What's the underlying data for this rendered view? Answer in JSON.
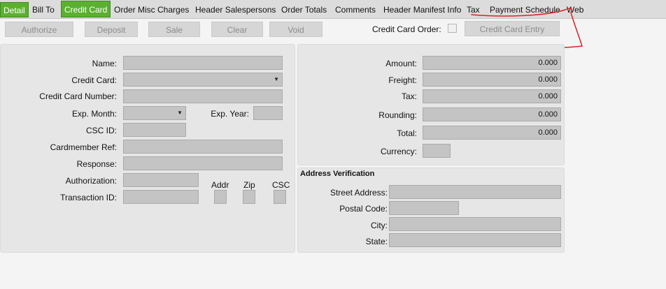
{
  "tabs": [
    {
      "label": "Detail"
    },
    {
      "label": "Bill To"
    },
    {
      "label": "Credit Card"
    },
    {
      "label": "Order Misc Charges"
    },
    {
      "label": "Header Salespersons"
    },
    {
      "label": "Order Totals"
    },
    {
      "label": "Comments"
    },
    {
      "label": "Header Manifest Info"
    },
    {
      "label": "Tax"
    },
    {
      "label": "Payment Schedule"
    },
    {
      "label": "Web"
    }
  ],
  "toolbar": {
    "authorize": "Authorize",
    "deposit": "Deposit",
    "sale": "Sale",
    "clear": "Clear",
    "void": "Void",
    "cc_order_label": "Credit Card Order:",
    "cc_entry": "Credit Card Entry"
  },
  "card": {
    "name_label": "Name:",
    "credit_card_label": "Credit Card:",
    "number_label": "Credit Card Number:",
    "exp_month_label": "Exp. Month:",
    "exp_year_label": "Exp. Year:",
    "csc_label": "CSC ID:",
    "cardmember_label": "Cardmember Ref:",
    "response_label": "Response:",
    "authorization_label": "Authorization:",
    "transaction_label": "Transaction ID:",
    "addr_label": "Addr",
    "zip_label": "Zip",
    "csc_check_label": "CSC"
  },
  "totals": {
    "amount_label": "Amount:",
    "amount_value": "0.000",
    "freight_label": "Freight:",
    "freight_value": "0.000",
    "tax_label": "Tax:",
    "tax_value": "0.000",
    "rounding_label": "Rounding:",
    "rounding_value": "0.000",
    "total_label": "Total:",
    "total_value": "0.000",
    "currency_label": "Currency:"
  },
  "address_verification": {
    "title": "Address Verification",
    "street_label": "Street Address:",
    "postal_label": "Postal Code:",
    "city_label": "City:",
    "state_label": "State:"
  },
  "colors": {
    "active_tab": "#5bb030",
    "annotation": "#e02020"
  }
}
